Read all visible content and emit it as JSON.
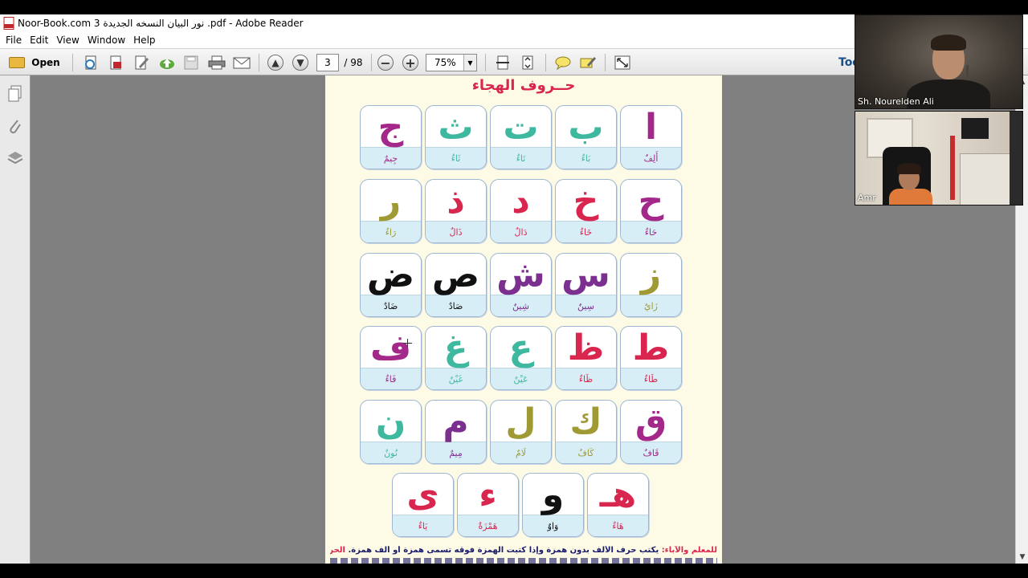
{
  "window": {
    "title": "Noor-Book.com  نور البيان النسخه الجديدة 3 .pdf - Adobe Reader"
  },
  "menu": [
    "File",
    "Edit",
    "View",
    "Window",
    "Help"
  ],
  "toolbar": {
    "open_label": "Open",
    "current_page": "3",
    "total_pages": "/ 98",
    "zoom": "75%",
    "tools_label": "Too"
  },
  "document": {
    "title": "حــروف الهجاء",
    "letters": [
      {
        "letter": "ا",
        "name": "أَلِفٌ",
        "color": "#a4288a"
      },
      {
        "letter": "ب",
        "name": "بَاءٌ",
        "color": "#3fb8a0"
      },
      {
        "letter": "ت",
        "name": "تَاءٌ",
        "color": "#3fb8a0"
      },
      {
        "letter": "ث",
        "name": "ثَاءٌ",
        "color": "#3fb8a0"
      },
      {
        "letter": "ج",
        "name": "جِيمٌ",
        "color": "#a4288a"
      },
      {
        "letter": "ح",
        "name": "حَاءٌ",
        "color": "#a4288a"
      },
      {
        "letter": "خ",
        "name": "خَاءٌ",
        "color": "#d9264f"
      },
      {
        "letter": "د",
        "name": "دَالٌ",
        "color": "#d9264f"
      },
      {
        "letter": "ذ",
        "name": "ذَالٌ",
        "color": "#d9264f"
      },
      {
        "letter": "ر",
        "name": "رَاءٌ",
        "color": "#a09a34"
      },
      {
        "letter": "ز",
        "name": "زَايٌ",
        "color": "#a09a34"
      },
      {
        "letter": "س",
        "name": "سِينٌ",
        "color": "#7b2f8f"
      },
      {
        "letter": "ش",
        "name": "شِينٌ",
        "color": "#7b2f8f"
      },
      {
        "letter": "ص",
        "name": "صَادٌ",
        "color": "#111111"
      },
      {
        "letter": "ض",
        "name": "ضَادٌ",
        "color": "#111111"
      },
      {
        "letter": "ط",
        "name": "طَاءٌ",
        "color": "#d9264f"
      },
      {
        "letter": "ظ",
        "name": "ظَاءٌ",
        "color": "#d9264f"
      },
      {
        "letter": "ع",
        "name": "عَيْنٌ",
        "color": "#3fb8a0"
      },
      {
        "letter": "غ",
        "name": "غَيْنٌ",
        "color": "#3fb8a0"
      },
      {
        "letter": "ف",
        "name": "فَاءٌ",
        "color": "#a4288a"
      },
      {
        "letter": "ق",
        "name": "قَافٌ",
        "color": "#a4288a"
      },
      {
        "letter": "ك",
        "name": "كَافٌ",
        "color": "#a09a34"
      },
      {
        "letter": "ل",
        "name": "لَامٌ",
        "color": "#a09a34"
      },
      {
        "letter": "م",
        "name": "مِيمٌ",
        "color": "#7b2f8f"
      },
      {
        "letter": "ن",
        "name": "نُونٌ",
        "color": "#3fb8a0"
      },
      {
        "letter": "هـ",
        "name": "هَاءٌ",
        "color": "#d9264f"
      },
      {
        "letter": "و",
        "name": "وَاوٌ",
        "color": "#111111"
      },
      {
        "letter": "ء",
        "name": "هَمْزَةٌ",
        "color": "#d9264f"
      },
      {
        "letter": "ى",
        "name": "يَاءٌ",
        "color": "#d9264f"
      }
    ],
    "footnote_label": "للمعلم والآباء:",
    "footnote_text": " يكتب حرف الألف بدون همزة وإذا كتبت الهمزة فوقه تسمى همزة أو ألف همزة. ",
    "footnote_tail": "الحروف"
  },
  "video": {
    "participant1": "Sh. Nourelden Ali",
    "participant2": "Amr"
  }
}
